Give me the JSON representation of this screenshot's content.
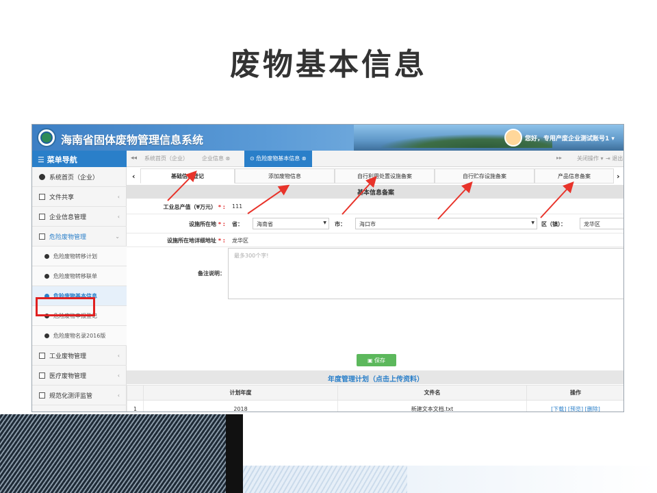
{
  "slide_title": "废物基本信息",
  "header": {
    "system_title": "海南省固体废物管理信息系统",
    "user_greeting": "您好，专用产废企业测试账号1 ▾"
  },
  "menu_title": "☰ 菜单导航",
  "tabs": {
    "prev_icon": "◂◂",
    "items": [
      {
        "label": "系统首页（企业）"
      },
      {
        "label": "企业信息 ⊗"
      },
      {
        "label": "⊙ 危险废物基本信息 ⊗"
      }
    ],
    "next_icon": "▸▸",
    "close_ops": "关闭操作 ▾",
    "logout": "⇥ 退出"
  },
  "sidebar": {
    "items": [
      {
        "label": "系统首页（企业）"
      },
      {
        "label": "文件共享",
        "chev": "‹"
      },
      {
        "label": "企业信息管理",
        "chev": "‹"
      },
      {
        "label": "危险废物管理",
        "chev": "⌄"
      },
      {
        "label": "危险废物转移计划"
      },
      {
        "label": "危险废物转移联单"
      },
      {
        "label": "危险废物基本信息"
      },
      {
        "label": "危险废物申报登记"
      },
      {
        "label": "危险废物名录2016版"
      },
      {
        "label": "工业废物管理",
        "chev": "‹"
      },
      {
        "label": "医疗废物管理",
        "chev": "‹"
      },
      {
        "label": "规范化测评监管",
        "chev": "‹"
      }
    ]
  },
  "subtabs": {
    "prev": "‹",
    "next": "›",
    "items": [
      {
        "label": "基础信息登记"
      },
      {
        "label": "添加废物信息"
      },
      {
        "label": "自行利用处置设施备案"
      },
      {
        "label": "自行贮存设施备案"
      },
      {
        "label": "产品信息备案"
      }
    ]
  },
  "form": {
    "section_title": "基本信息备案",
    "output_label": "工业总产值（¥万元）",
    "output_value": "111",
    "location_label": "设施所在地",
    "province_label": "省：",
    "province_value": "海南省",
    "city_label": "市：",
    "city_value": "海口市",
    "district_label": "区（镇）：",
    "district_value": "龙华区",
    "address_label": "设施所在地详细地址",
    "address_value": "龙华区",
    "remark_label": "备注说明：",
    "remark_placeholder": "最多300个字!",
    "required_mark": " * :",
    "save_label": "保存"
  },
  "plan": {
    "title": "年度管理计划（点击上传资料）",
    "columns": [
      "计划年度",
      "文件名",
      "操作"
    ],
    "rows": [
      {
        "index": "1",
        "year": "2018",
        "file": "新建文本文档.txt",
        "download": "[下载]",
        "preview": "[预览]",
        "delete": "[删除]"
      }
    ]
  },
  "colors": {
    "accent": "#2a7fc9",
    "highlight": "#e02020",
    "save": "#5cb85c"
  }
}
